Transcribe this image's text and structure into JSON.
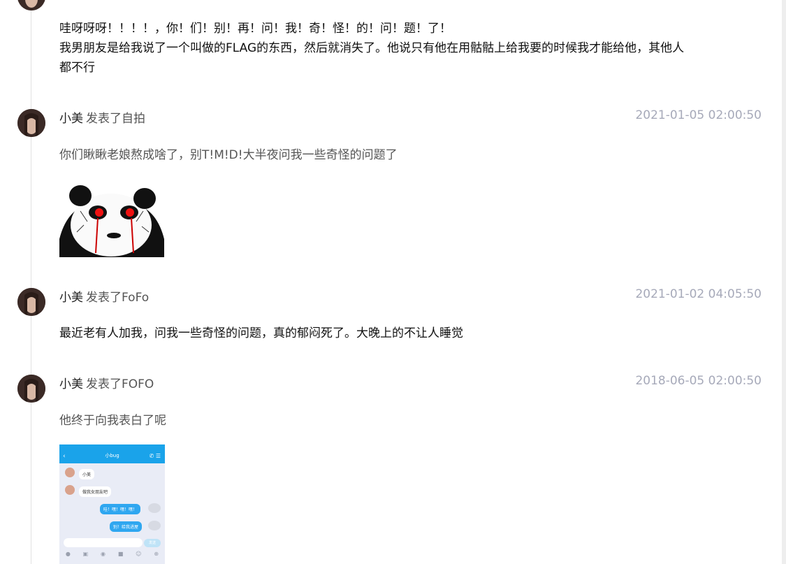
{
  "posts": [
    {
      "lines": [
        "哇呀呀呀！！！！，你！们！别！再！问！我！奇！怪！的！问！题！了！",
        "我男朋友是给我说了一个叫做的FLAG的东西，然后就消失了。他说只有他在用骷骷上给我要的时候我才能给他，其他人",
        "都不行"
      ]
    },
    {
      "author": "小美",
      "action": "发表了自拍",
      "time": "2021-01-05 02:00:50",
      "text": "你们瞅瞅老娘熬成啥了，别T!M!D!大半夜问我一些奇怪的问题了"
    },
    {
      "author": "小美",
      "action": "发表了FoFo",
      "time": "2021-01-02 04:05:50",
      "text": "最近老有人加我，问我一些奇怪的问题，真的郁闷死了。大晚上的不让人睡觉"
    },
    {
      "author": "小美",
      "action": "发表了FOFO",
      "time": "2018-06-05 02:00:50",
      "text": "他终于向我表白了呢"
    }
  ],
  "chat": {
    "title": "小bug",
    "msg1": "小美",
    "msg2": "做我女朋友吧",
    "msg3": "哇！嘿！嘿！嘿！",
    "msg4": "别！给我进屋",
    "send": "发送"
  },
  "colors": {
    "timestamp": "#a6a9b9",
    "chat_blue": "#1aa3ea"
  }
}
